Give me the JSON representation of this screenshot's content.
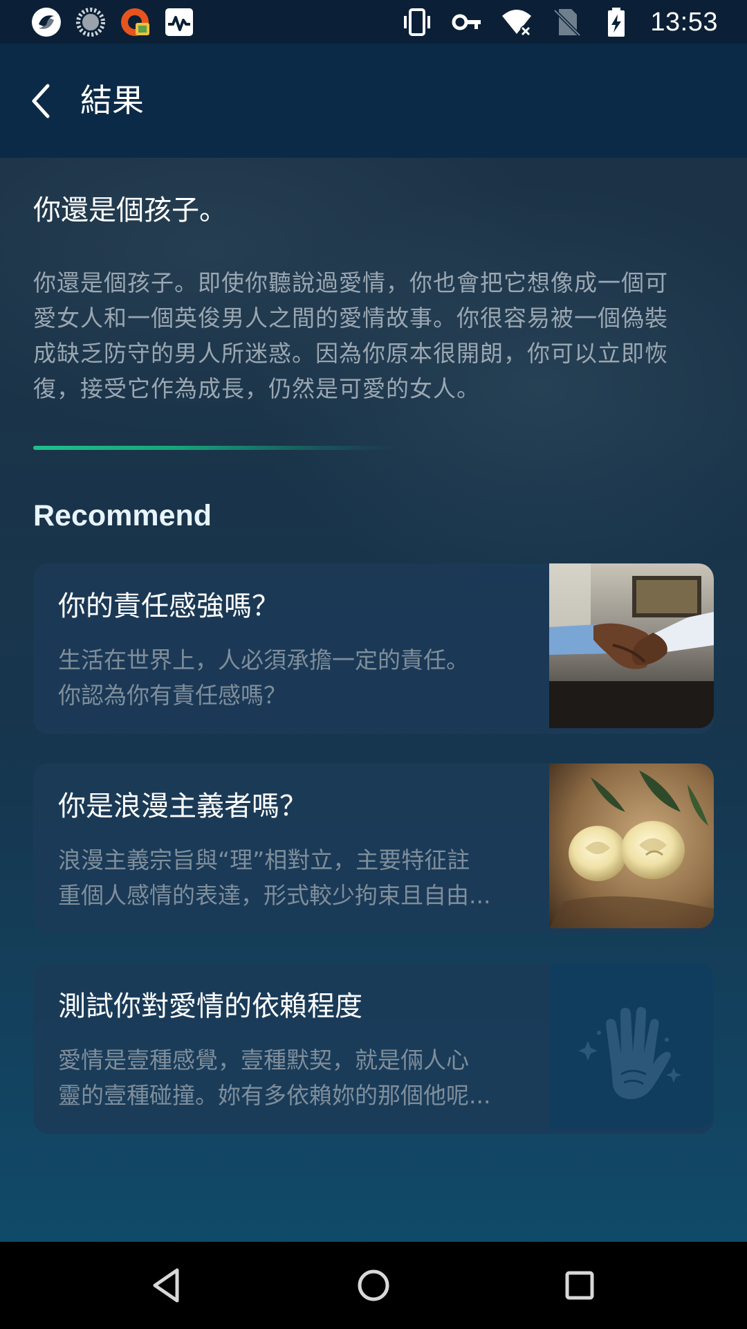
{
  "status_bar": {
    "time": "13:53",
    "left_icons": [
      "app-logo-icon",
      "loading-circle-icon",
      "orange-app-icon",
      "activity-monitor-icon"
    ],
    "right_icons": [
      "vibrate-icon",
      "vpn-key-icon",
      "wifi-off-icon",
      "no-sim-icon",
      "battery-charging-icon"
    ]
  },
  "app_bar": {
    "back_icon": "chevron-left-icon",
    "title": "結果"
  },
  "result": {
    "title": "你還是個孩子。",
    "description_lines": [
      "你還是個孩子。即使你聽說過愛情，你也會把它想像成一個可",
      "愛女人和一個英俊男人之間的愛情故事。你很容易被一個偽裝",
      "成缺乏防守的男人所迷惑。因為你原本很開朗，你可以立即恢",
      "復，接受它作為成長，仍然是可愛的女人。"
    ],
    "divider_color": "#1fc08a"
  },
  "recommend": {
    "heading": "Recommend",
    "cards": [
      {
        "title": "你的責任感強嗎？",
        "desc_lines": [
          "生活在世界上，人必須承擔一定的責任。",
          "你認為你有責任感嗎？"
        ],
        "image": "handshake-photo"
      },
      {
        "title": "你是浪漫主義者嗎？",
        "desc_lines": [
          "浪漫主義宗旨與“理”相對立，主要特征註",
          "重個人感情的表達，形式較少拘束且自由..."
        ],
        "image": "white-roses-photo"
      },
      {
        "title": "測試你對愛情的依賴程度",
        "desc_lines": [
          "愛情是壹種感覺，壹種默契，就是倆人心",
          "靈的壹種碰撞。妳有多依賴妳的那個他呢..."
        ],
        "image": "palm-hand-icon"
      }
    ]
  },
  "nav_bar": {
    "buttons": [
      "back-triangle-icon",
      "home-circle-icon",
      "recents-square-icon"
    ]
  }
}
